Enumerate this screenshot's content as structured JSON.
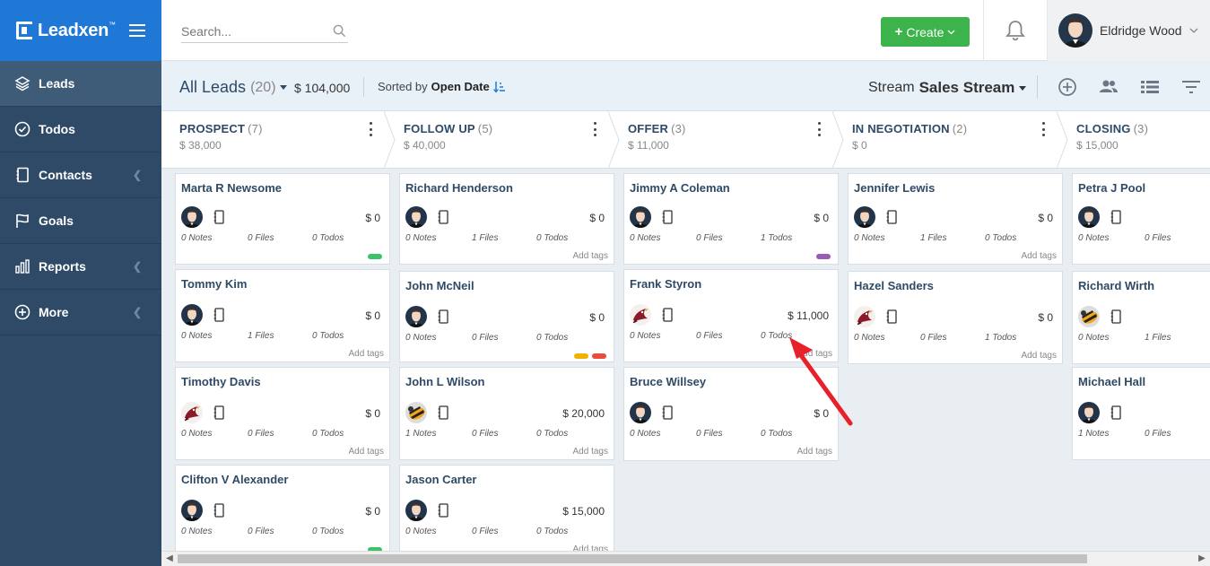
{
  "brand": {
    "name": "Leadxen",
    "tm": "™"
  },
  "sidebar": {
    "items": [
      {
        "label": "Leads",
        "icon": "layers-icon",
        "active": true,
        "has_chevron": false
      },
      {
        "label": "Todos",
        "icon": "check-circle-icon",
        "active": false,
        "has_chevron": false
      },
      {
        "label": "Contacts",
        "icon": "address-book-icon",
        "active": false,
        "has_chevron": true
      },
      {
        "label": "Goals",
        "icon": "flag-icon",
        "active": false,
        "has_chevron": false
      },
      {
        "label": "Reports",
        "icon": "bar-chart-icon",
        "active": false,
        "has_chevron": true
      },
      {
        "label": "More",
        "icon": "plus-circle-icon",
        "active": false,
        "has_chevron": true
      }
    ]
  },
  "header": {
    "search_placeholder": "Search...",
    "create_label": "Create",
    "user_name": "Eldridge Wood"
  },
  "toolbar": {
    "title": "All Leads",
    "count": "(20)",
    "total": "$ 104,000",
    "sorted_prefix": "Sorted by",
    "sorted_field": "Open Date",
    "stream_prefix": "Stream",
    "stream_name": "Sales Stream"
  },
  "stages": [
    {
      "name": "PROSPECT",
      "count": "(7)",
      "amount": "$ 38,000"
    },
    {
      "name": "FOLLOW UP",
      "count": "(5)",
      "amount": "$ 40,000"
    },
    {
      "name": "OFFER",
      "count": "(3)",
      "amount": "$ 11,000"
    },
    {
      "name": "IN NEGOTIATION",
      "count": "(2)",
      "amount": "$ 0"
    },
    {
      "name": "CLOSING",
      "count": "(3)",
      "amount": "$ 15,000"
    }
  ],
  "columns": [
    [
      {
        "name": "Marta R Newsome",
        "avatar": "man",
        "value": "$ 0",
        "notes": "0 Notes",
        "files": "0 Files",
        "todos": "0 Todos",
        "tags_label": "",
        "tags": [
          "#3cc36a"
        ]
      },
      {
        "name": "Tommy Kim",
        "avatar": "man",
        "value": "$ 0",
        "notes": "0 Notes",
        "files": "1 Files",
        "todos": "0 Todos",
        "tags_label": "Add tags",
        "tags": []
      },
      {
        "name": "Timothy Davis",
        "avatar": "bird",
        "value": "$ 0",
        "notes": "0 Notes",
        "files": "0 Files",
        "todos": "0 Todos",
        "tags_label": "Add tags",
        "tags": []
      },
      {
        "name": "Clifton V Alexander",
        "avatar": "man",
        "value": "$ 0",
        "notes": "0 Notes",
        "files": "0 Files",
        "todos": "0 Todos",
        "tags_label": "",
        "tags": [
          "#3cc36a"
        ]
      }
    ],
    [
      {
        "name": "Richard Henderson",
        "avatar": "man",
        "value": "$ 0",
        "notes": "0 Notes",
        "files": "1 Files",
        "todos": "0 Todos",
        "tags_label": "Add tags",
        "tags": []
      },
      {
        "name": "John McNeil",
        "avatar": "man",
        "value": "$ 0",
        "notes": "0 Notes",
        "files": "0 Files",
        "todos": "0 Todos",
        "tags_label": "",
        "tags": [
          "#f0b400",
          "#e74c3c"
        ]
      },
      {
        "name": "John L Wilson",
        "avatar": "bee",
        "value": "$ 20,000",
        "notes": "1 Notes",
        "files": "0 Files",
        "todos": "0 Todos",
        "tags_label": "Add tags",
        "tags": []
      },
      {
        "name": "Jason Carter",
        "avatar": "man",
        "value": "$ 15,000",
        "notes": "0 Notes",
        "files": "0 Files",
        "todos": "0 Todos",
        "tags_label": "Add tags",
        "tags": []
      }
    ],
    [
      {
        "name": "Jimmy A Coleman",
        "avatar": "man",
        "value": "$ 0",
        "notes": "0 Notes",
        "files": "0 Files",
        "todos": "1 Todos",
        "tags_label": "",
        "tags": [
          "#9b59b6"
        ]
      },
      {
        "name": "Frank Styron",
        "avatar": "bird",
        "value": "$ 11,000",
        "notes": "0 Notes",
        "files": "0 Files",
        "todos": "0 Todos",
        "tags_label": "Add tags",
        "tags": []
      },
      {
        "name": "Bruce Willsey",
        "avatar": "man",
        "value": "$ 0",
        "notes": "0 Notes",
        "files": "0 Files",
        "todos": "0 Todos",
        "tags_label": "Add tags",
        "tags": []
      }
    ],
    [
      {
        "name": "Jennifer Lewis",
        "avatar": "man",
        "value": "$ 0",
        "notes": "0 Notes",
        "files": "1 Files",
        "todos": "0 Todos",
        "tags_label": "Add tags",
        "tags": []
      },
      {
        "name": "Hazel Sanders",
        "avatar": "bird",
        "value": "$ 0",
        "notes": "0 Notes",
        "files": "0 Files",
        "todos": "1 Todos",
        "tags_label": "Add tags",
        "tags": []
      }
    ],
    [
      {
        "name": "Petra J Pool",
        "avatar": "man",
        "value": "",
        "notes": "0 Notes",
        "files": "0 Files",
        "todos": "",
        "tags_label": "",
        "tags": []
      },
      {
        "name": "Richard Wirth",
        "avatar": "bee",
        "value": "",
        "notes": "0 Notes",
        "files": "1 Files",
        "todos": "",
        "tags_label": "",
        "tags": []
      },
      {
        "name": "Michael Hall",
        "avatar": "man",
        "value": "",
        "notes": "1 Notes",
        "files": "0 Files",
        "todos": "",
        "tags_label": "",
        "tags": []
      }
    ]
  ],
  "colors": {
    "brand": "#1f78d6",
    "sidebar": "#2e4a66",
    "create": "#3cb44b",
    "annotation": "#e8202a"
  }
}
